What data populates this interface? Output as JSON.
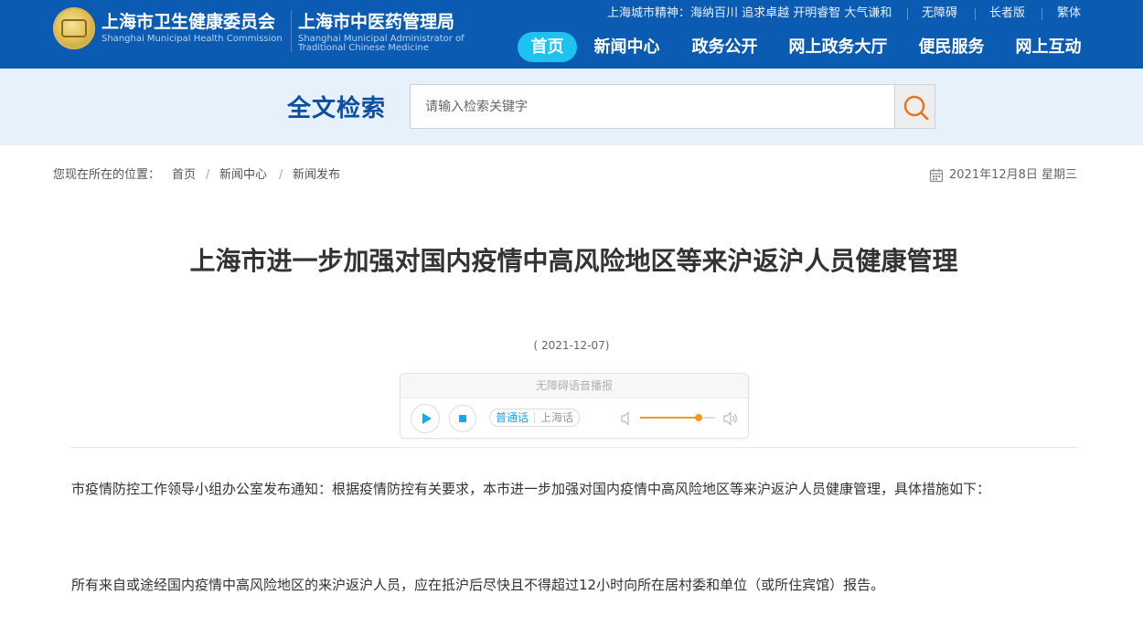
{
  "header": {
    "org_name_cn": "上海市卫生健康委员会",
    "org_name_en": "Shanghai Municipal Health Commission",
    "org2_name_cn": "上海市中医药管理局",
    "org2_name_en_line1": "Shanghai Municipal Administrator of",
    "org2_name_en_line2": "Traditional Chinese Medicine",
    "city_spirit": "上海城市精神：海纳百川 追求卓越 开明睿智 大气谦和",
    "links": [
      "无障碍",
      "长者版",
      "繁体"
    ],
    "nav": [
      "首页",
      "新闻中心",
      "政务公开",
      "网上政务大厅",
      "便民服务",
      "网上互动"
    ],
    "nav_active": "首页",
    "brand_color": "#0c5bb3",
    "active_color": "#1ec2ef"
  },
  "search": {
    "title": "全文检索",
    "placeholder": "请输入检索关键字",
    "icon": "search-icon",
    "icon_color": "#e8731e"
  },
  "breadcrumb": {
    "prefix": "您现在所在的位置：",
    "items": [
      "首页",
      "新闻中心",
      "新闻发布"
    ],
    "separator": "/",
    "date": "2021年12月8日 星期三",
    "date_icon": "calendar-icon"
  },
  "article": {
    "title": "上海市进一步加强对国内疫情中高风险地区等来沪返沪人员健康管理",
    "date": "( 2021-12-07)",
    "player": {
      "header": "无障碍语音播报",
      "play_icon": "play-icon",
      "stop_icon": "stop-icon",
      "languages": [
        "普通话",
        "上海话"
      ],
      "active_language": "普通话",
      "volume_level": 0.78,
      "volume_color": "#f39a1e"
    },
    "paragraphs": [
      "市疫情防控工作领导小组办公室发布通知：根据疫情防控有关要求，本市进一步加强对国内疫情中高风险地区等来沪返沪人员健康管理，具体措施如下：",
      "所有来自或途经国内疫情中高风险地区的来沪返沪人员，应在抵沪后尽快且不得超过12小时向所在居村委和单位（或所住宾馆）报告。"
    ]
  }
}
